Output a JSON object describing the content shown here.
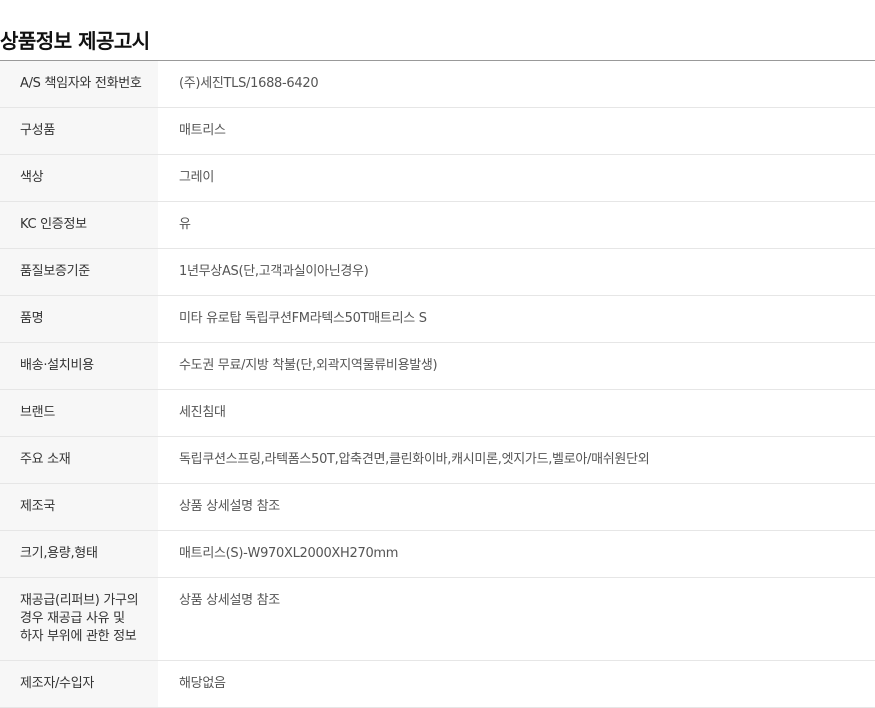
{
  "title": "상품정보 제공고시",
  "rows": [
    {
      "label": "A/S 책임자와 전화번호",
      "value": "(주)세진TLS/1688-6420"
    },
    {
      "label": "구성품",
      "value": "매트리스"
    },
    {
      "label": "색상",
      "value": "그레이"
    },
    {
      "label": "KC 인증정보",
      "value": "유"
    },
    {
      "label": "품질보증기준",
      "value": "1년무상AS(단,고객과실이아닌경우)"
    },
    {
      "label": "품명",
      "value": "미타 유로탑 독립쿠션FM라텍스50T매트리스 S"
    },
    {
      "label": "배송·설치비용",
      "value": "수도권 무료/지방 착불(단,외곽지역물류비용발생)"
    },
    {
      "label": "브랜드",
      "value": "세진침대"
    },
    {
      "label": "주요 소재",
      "value": "독립쿠션스프링,라텍폼스50T,압축견면,클린화이바,캐시미론,엣지가드,벨로아/매쉬원단외"
    },
    {
      "label": "제조국",
      "value": "상품 상세설명 참조"
    },
    {
      "label": "크기,용량,형태",
      "value": "매트리스(S)-W970XL2000XH270mm"
    },
    {
      "label": "재공급(리퍼브) 가구의 경우 재공급 사유 및 하자 부위에 관한 정보",
      "value": "상품 상세설명 참조"
    },
    {
      "label": "제조자/수입자",
      "value": "해당없음"
    }
  ]
}
